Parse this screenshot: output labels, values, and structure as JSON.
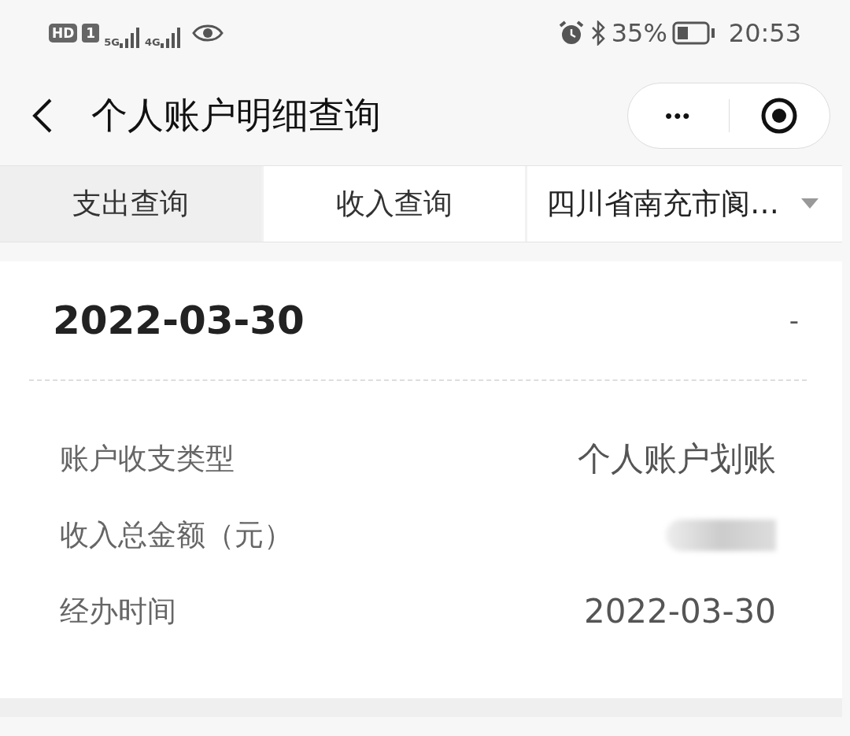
{
  "status_bar": {
    "hd": "HD",
    "sim": "1",
    "network_1": "5G",
    "network_2": "4G",
    "battery": "35%",
    "time": "20:53"
  },
  "nav": {
    "title": "个人账户明细查询",
    "more": "•••"
  },
  "tabs": [
    {
      "label": "支出查询",
      "selected": false
    },
    {
      "label": "收入查询",
      "selected": true
    }
  ],
  "region_dropdown": {
    "value": "四川省南充市阆…"
  },
  "record": {
    "date": "2022-03-30",
    "mark": "-",
    "rows": [
      {
        "kind": "text",
        "label": "账户收支类型",
        "value": "个人账户划账"
      },
      {
        "kind": "redacted",
        "label": "收入总金额（元）"
      },
      {
        "kind": "text",
        "label": "经办时间",
        "value": "2022-03-30"
      }
    ]
  }
}
